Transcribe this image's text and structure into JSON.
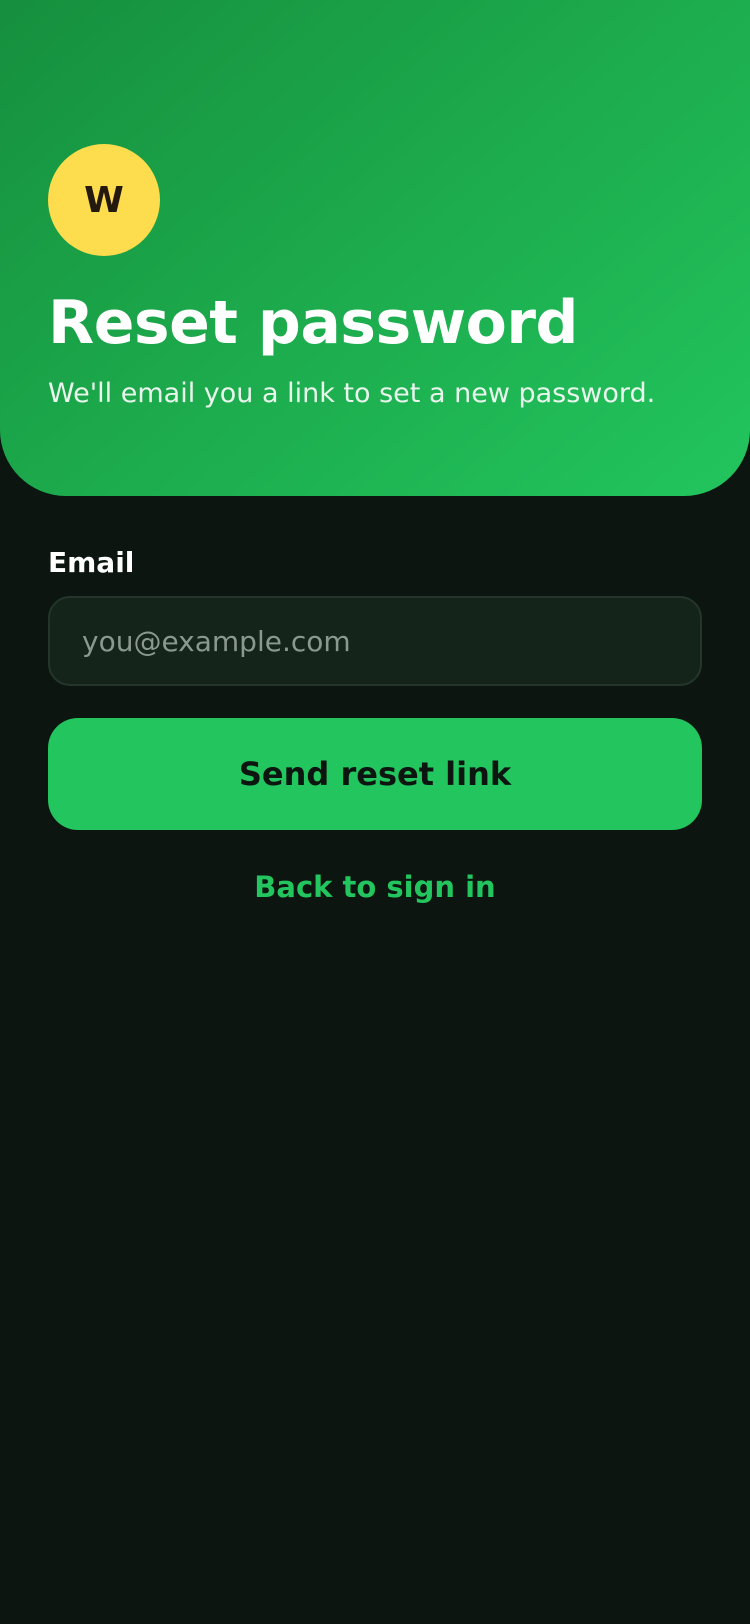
{
  "header": {
    "logo_letter": "W",
    "title": "Reset password",
    "subtitle": "We'll email you a link to set a new password."
  },
  "form": {
    "email_label": "Email",
    "email_value": "",
    "email_placeholder": "you@example.com",
    "submit_label": "Send reset link",
    "back_link": "Back to sign in"
  },
  "colors": {
    "accent": "#22c55e",
    "logo_background": "#fddc4d",
    "background": "#0c1510",
    "input_background": "#14241a"
  }
}
